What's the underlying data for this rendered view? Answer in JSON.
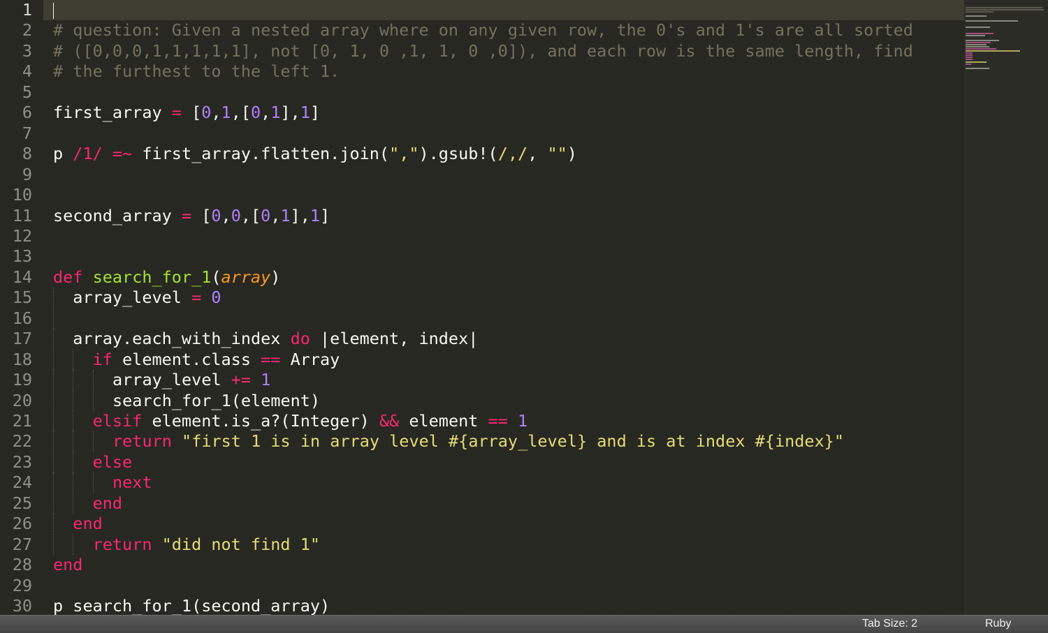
{
  "editor": {
    "line_numbers": [
      "1",
      "2",
      "3",
      "4",
      "5",
      "6",
      "7",
      "8",
      "9",
      "10",
      "11",
      "12",
      "13",
      "14",
      "15",
      "16",
      "17",
      "18",
      "19",
      "20",
      "21",
      "22",
      "23",
      "24",
      "25",
      "26",
      "27",
      "28",
      "29",
      "30"
    ],
    "active_line": "1",
    "lines": {
      "l2": "# question: Given a nested array where on any given row, the 0's and 1's are all sorted",
      "l3": "# ([0,0,0,1,1,1,1,1], not [0, 1, 0 ,1, 1, 0 ,0]), and each row is the same length, find",
      "l4": "# the furthest to the left 1.",
      "l6": {
        "a": "first_array ",
        "b": "=",
        "c": " [",
        "d": "0",
        ",1": ",",
        "e": "1",
        "f": ",[",
        "g": "0",
        "h": ",",
        "i": "1",
        "j": "],",
        "k": "1",
        "l": "]"
      },
      "l8": {
        "a": "p ",
        "b": "/1/",
        "c": " ",
        "d": "=~",
        "e": " first_array.flatten.join(",
        "f": "\",\"",
        "g": ").gsub!(",
        "h": "/,/",
        "i": ", ",
        "j": "\"\"",
        "k": ")"
      },
      "l11": {
        "a": "second_array ",
        "b": "=",
        "c": " [",
        "d": "0",
        "e": ",",
        "f": "0",
        "g": ",[",
        "h": "0",
        "i": ",",
        "j": "1",
        "k": "],",
        "l": "1",
        "m": "]"
      },
      "l14": {
        "a": "def",
        "b": " ",
        "c": "search_for_1",
        "d": "(",
        "e": "array",
        "f": ")"
      },
      "l15": {
        "a": "array_level ",
        "b": "=",
        "c": " ",
        "d": "0"
      },
      "l17": {
        "a": "array.each_with_index ",
        "b": "do",
        "c": " |element, index|"
      },
      "l18": {
        "a": "if",
        "b": " element.class ",
        "c": "==",
        "d": " Array"
      },
      "l19": {
        "a": "array_level ",
        "b": "+=",
        "c": " ",
        "d": "1"
      },
      "l20": "search_for_1(element)",
      "l21": {
        "a": "elsif",
        "b": " element.is_a?(Integer) ",
        "c": "&&",
        "d": " element ",
        "e": "==",
        "f": " ",
        "g": "1"
      },
      "l22": {
        "a": "return",
        "b": " ",
        "c": "\"first 1 is in array level #{array_level} and is at index #{index}\""
      },
      "l23": "else",
      "l24": "next",
      "l25": "end",
      "l26": "end",
      "l27": {
        "a": "return",
        "b": " ",
        "c": "\"did not find 1\""
      },
      "l28": "end",
      "l30": "p search_for_1(second_array)"
    }
  },
  "colors": {
    "background": "#272822",
    "comment": "#75715e",
    "keyword": "#f92672",
    "number": "#ae81ff",
    "string": "#e6db74",
    "function": "#a6e22e",
    "parameter": "#fd971f"
  },
  "statusbar": {
    "tab_size": "Tab Size: 2",
    "syntax": "Ruby"
  }
}
